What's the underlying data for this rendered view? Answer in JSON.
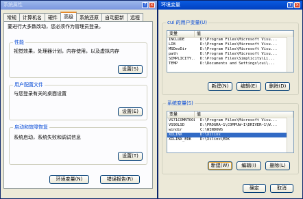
{
  "sysprops": {
    "title": "系统属性",
    "help": "?",
    "close": "×",
    "tabs": [
      "常规",
      "计算机名",
      "硬件",
      "高级",
      "系统还原",
      "自动更新",
      "远程"
    ],
    "admin_note": "要进行大多数改动，您必须作为管理员登录。",
    "performance": {
      "title": "性能",
      "desc": "视觉效果，处理器计划，内存使用，以及虚拟内存",
      "button": "设置(S)"
    },
    "profiles": {
      "title": "用户配置文件",
      "desc": "与您登录有关的桌面设置",
      "button": "设置(E)"
    },
    "startup": {
      "title": "启动和故障恢复",
      "desc": "系统启动，系统失败和调试信息",
      "button": "设置(T)"
    },
    "env_button": "环境变量(N)",
    "error_button": "错误报告(R)"
  },
  "envvars": {
    "title": "环境变量",
    "help": "?",
    "close": "×",
    "user_group_label": "cui 的用户变量(U)",
    "col_var": "变量",
    "col_val": "值",
    "user_vars": [
      {
        "name": "INCLUDE",
        "value": "D:\\Program Files\\Microsoft Visu..."
      },
      {
        "name": "LIB",
        "value": "D:\\Program Files\\Microsoft Visu..."
      },
      {
        "name": "MSDevDir",
        "value": "D:\\Program Files\\Microsoft Visu..."
      },
      {
        "name": "path",
        "value": "D:\\Program Files\\Microsoft Visu..."
      },
      {
        "name": "SIMPLICITY...",
        "value": "D:\\Program Files\\Simplicity\\Li..."
      },
      {
        "name": "TEMP",
        "value": "D:\\Documents and Settings\\cui\\..."
      }
    ],
    "user_buttons": [
      "新建(N)",
      "编辑(E)",
      "删除(D)"
    ],
    "sys_group_label": "系统变量(S)",
    "sys_vars": [
      {
        "name": "VS71COMNTOOLS",
        "value": "D:\\Program Files\\Microsoft Visu..."
      },
      {
        "name": "VS90LSD",
        "value": "D:\\PROGRA~1\\COMPUW~1\\DRIVER~1\\W..."
      },
      {
        "name": "windir",
        "value": "C:\\WINDOWS"
      },
      {
        "name": "XILINX",
        "value": "D:\\Xilinx"
      },
      {
        "name": "XILINX_EDK",
        "value": "D:\\Xilinx\\EDK"
      }
    ],
    "selected_sys_index": 3,
    "sys_buttons": [
      "新建(W)",
      "编辑(I)",
      "删除(L)"
    ],
    "ok": "确定",
    "cancel": "取消"
  }
}
